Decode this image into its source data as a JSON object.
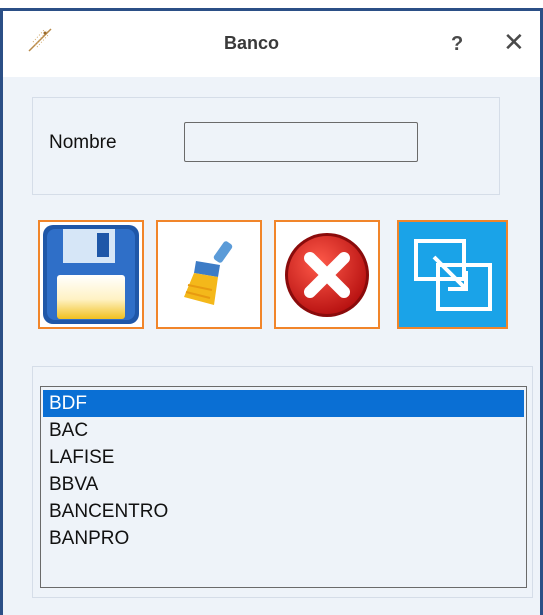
{
  "window": {
    "title": "Banco",
    "help_label": "?",
    "close_label": "✕",
    "app_icon": "quill-icon"
  },
  "form": {
    "nombre_label": "Nombre",
    "nombre_value": ""
  },
  "toolbar": {
    "buttons": [
      {
        "name": "save-button",
        "icon": "floppy-disk-icon"
      },
      {
        "name": "clear-button",
        "icon": "broom-icon"
      },
      {
        "name": "cancel-button",
        "icon": "red-x-icon"
      },
      {
        "name": "select-button",
        "icon": "windows-arrow-icon"
      }
    ]
  },
  "list": {
    "items": [
      "BDF",
      "BAC",
      "LAFISE",
      "BBVA",
      "BANCENTRO",
      "BANPRO"
    ],
    "selected_index": 0
  },
  "colors": {
    "accent_orange": "#f1852a",
    "selection_blue": "#0a6fd4",
    "select_button_blue": "#1aa3e8",
    "window_border": "#2b4f86"
  }
}
